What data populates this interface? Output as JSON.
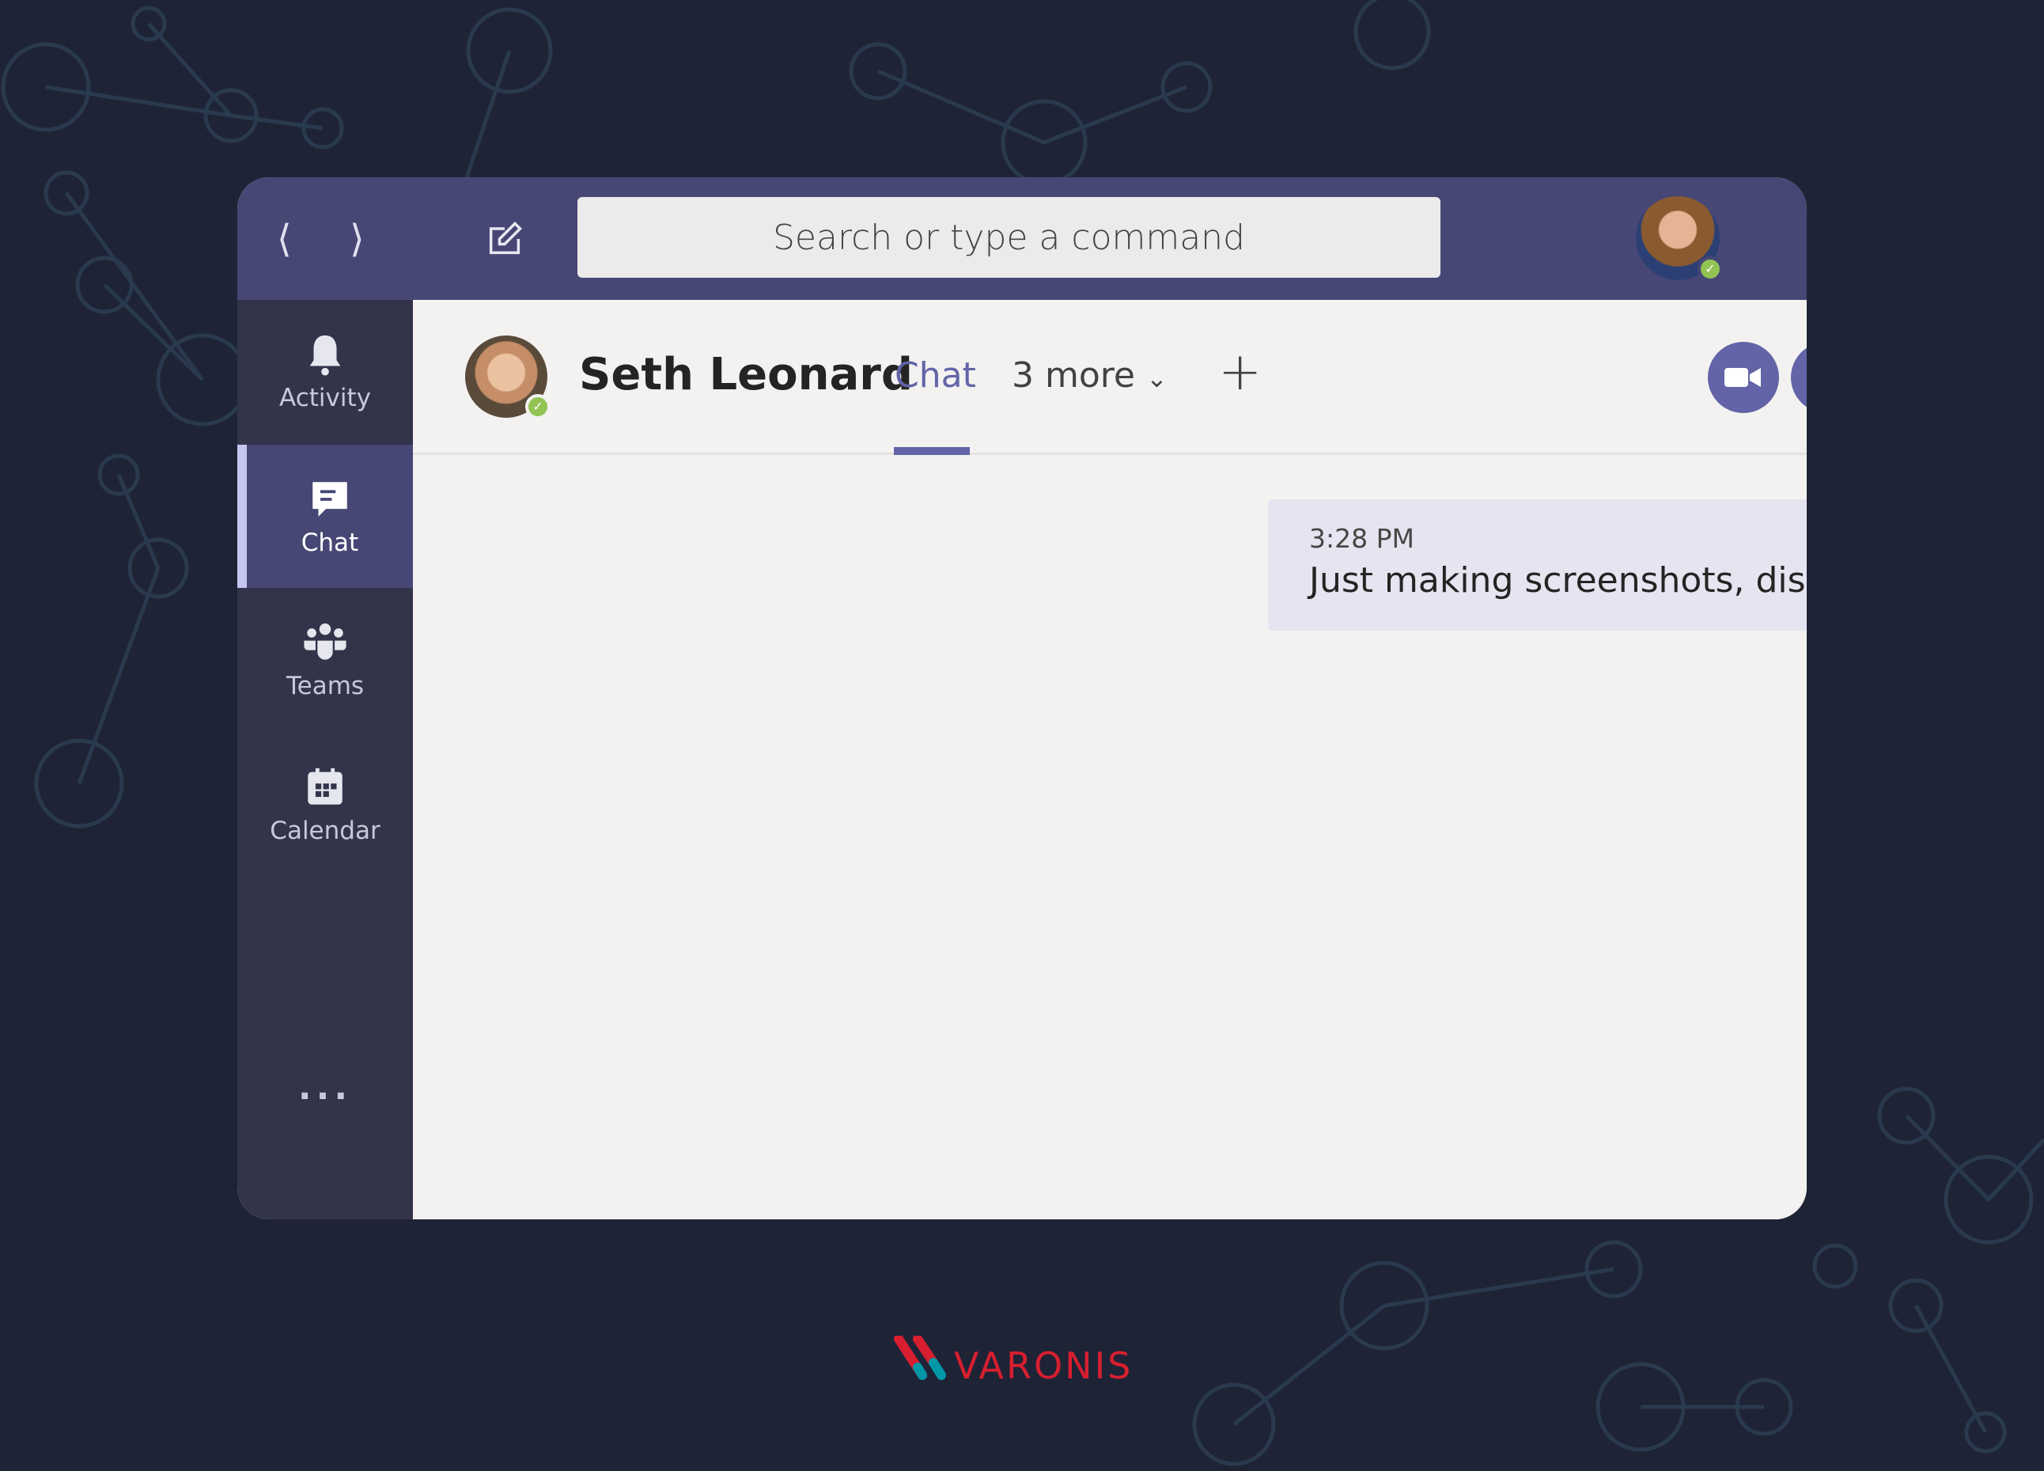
{
  "titlebar": {
    "back_icon": "chevron-left",
    "forward_icon": "chevron-right",
    "compose_icon": "compose-icon",
    "search_placeholder": "Search or type a command"
  },
  "sidebar": {
    "items": [
      {
        "label": "Activity",
        "icon": "bell-icon",
        "active": false
      },
      {
        "label": "Chat",
        "icon": "chat-icon",
        "active": true
      },
      {
        "label": "Teams",
        "icon": "teams-icon",
        "active": false
      },
      {
        "label": "Calendar",
        "icon": "calendar-icon",
        "active": false
      }
    ],
    "more_label": "..."
  },
  "chat": {
    "contact_name": "Seth Leonard",
    "status": "available",
    "tabs": {
      "active": "Chat",
      "more": "3 more"
    },
    "add_tab": "+"
  },
  "messages": [
    {
      "time": "3:28 PM",
      "text": "Just making screenshots, disreg"
    }
  ],
  "brand": {
    "logo": "VARONIS",
    "red": "#d71f2f",
    "teal": "#0097a7"
  },
  "colors": {
    "accent": "#6264a7",
    "titlebar": "#464775",
    "sidebar": "#33344a",
    "presence": "#92c353"
  }
}
